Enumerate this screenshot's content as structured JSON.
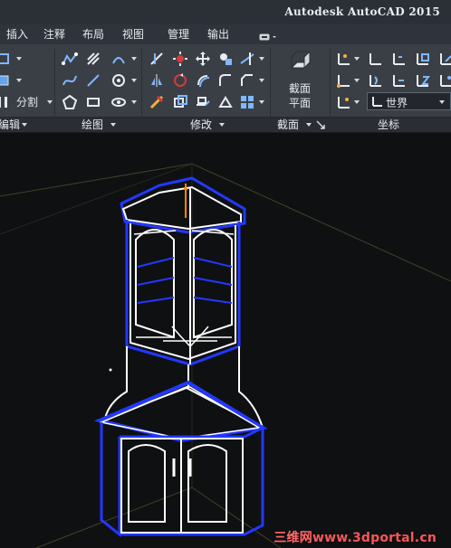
{
  "window": {
    "title": "Autodesk AutoCAD 2015"
  },
  "tabs": [
    {
      "label": "插入"
    },
    {
      "label": "注释"
    },
    {
      "label": "布局"
    },
    {
      "label": "视图"
    },
    {
      "label": "管理"
    },
    {
      "label": "输出"
    }
  ],
  "ribbon": {
    "groups": {
      "edit": {
        "label": "编辑"
      },
      "draw": {
        "label": "绘图"
      },
      "modify": {
        "label": "修改"
      },
      "section": {
        "label": "截面"
      },
      "coordinates": {
        "label": "坐标"
      }
    },
    "edit_split_label": "分割",
    "section_plane_label_line1": "截面",
    "section_plane_label_line2": "平面",
    "ucs_named_value": "世界"
  },
  "watermark": {
    "cjk": "三维网",
    "site": "www.3dportal.cn"
  },
  "colors": {
    "background": "#111214",
    "titlebar": "#2b2f36",
    "tabbar": "#2f343c",
    "ribbon": "#3a3f46",
    "ribbon_footer": "#2a2e34",
    "model_white": "#ffffff",
    "model_blue": "#1a2bff",
    "model_orange": "#ff8a00",
    "watermark_red": "#f25a5a"
  }
}
